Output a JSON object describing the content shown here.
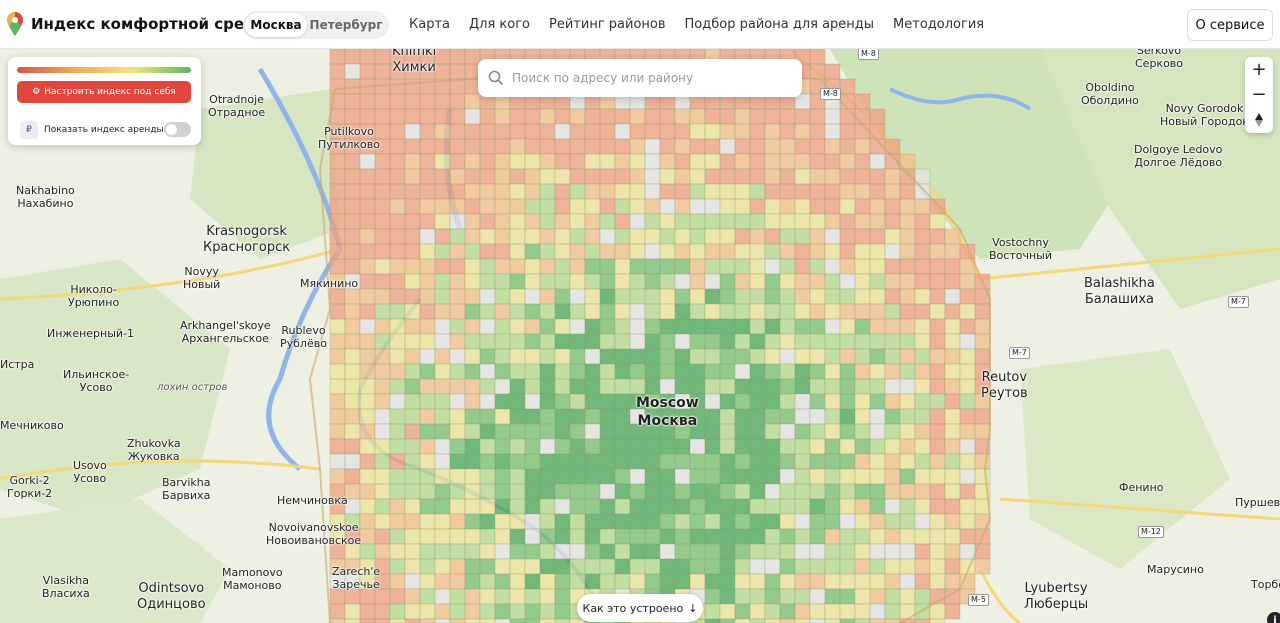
{
  "header": {
    "title": "Индекс комфортной среды",
    "cities": [
      "Москва",
      "Петербург"
    ],
    "nav": [
      "Карта",
      "Для кого",
      "Рейтинг районов",
      "Подбор района для аренды",
      "Методология"
    ],
    "about": "О сервисе"
  },
  "panel": {
    "customize": "Настроить индекс под себя",
    "ruble": "₽",
    "rent_toggle": "Показать индекс аренды",
    "rent_toggle_on": false
  },
  "search": {
    "placeholder": "Поиск по адресу или району"
  },
  "zoom": {
    "plus": "+",
    "minus": "−"
  },
  "bottom": {
    "how": "Как это устроено",
    "arrow": "↓",
    "info": "i"
  },
  "colors": {
    "accent": "#e0463c",
    "good": "#5cb85c",
    "bad": "#e9967a"
  },
  "map_labels": {
    "khimki": [
      "Khimki",
      "Химки"
    ],
    "otradnoe": [
      "Otradnoje",
      "Отрадное"
    ],
    "putilkovo": [
      "Putilkovo",
      "Путилково"
    ],
    "nakhabino": [
      "Nakhabino",
      "Нахабино"
    ],
    "krasnogorsk": [
      "Krasnogorsk",
      "Красногорск"
    ],
    "novyy": [
      "Novyy",
      "Новый"
    ],
    "myakinino": "Мякинино",
    "nikolo": [
      "Николо-",
      "Урюпино"
    ],
    "inzhenerny": "Инженерный-1",
    "arkhangelskoye": [
      "Arkhangel'skoye",
      "Архангельское"
    ],
    "rublevo": [
      "Rublevo",
      "Рублёво"
    ],
    "istra": "Истра",
    "ilinskoe": [
      "Ильинское-",
      "Усово"
    ],
    "lokhin": "лохин остров",
    "mechnikovo": "Мечниково",
    "zhukovka": [
      "Zhukovka",
      "Жуковка"
    ],
    "usovo": [
      "Usovo",
      "Усово"
    ],
    "gorki": [
      "Gorki-2",
      "Горки-2"
    ],
    "barvikha": [
      "Barvikha",
      "Барвиха"
    ],
    "nemchinovka": "Немчиновка",
    "novoivanovskoe": [
      "Novoivanovskoe",
      "Новоивановское"
    ],
    "zarechye": [
      "Zarech'e",
      "Заречье"
    ],
    "mamonovo": [
      "Mamonovo",
      "Мамоново"
    ],
    "vlasikha": [
      "Vlasikha",
      "Власиха"
    ],
    "odintsovo": [
      "Odintsovo",
      "Одинцово"
    ],
    "moscow": [
      "Moscow",
      "Москва"
    ],
    "serkovo": [
      "Serkovo",
      "Серково"
    ],
    "oboldino": [
      "Oboldino",
      "Оболдино"
    ],
    "novy_gorodok": [
      "Novy Gorodok",
      "Новый Городок"
    ],
    "dolgoye": [
      "Dolgoye Ledovo",
      "Долгое Лёдово"
    ],
    "vostochny": [
      "Vostochny",
      "Восточный"
    ],
    "balashikha": [
      "Balashikha",
      "Балашиха"
    ],
    "reutov": [
      "Reutov",
      "Реутов"
    ],
    "fenino": "Фенино",
    "purshevo": "Пуршево",
    "marusino": "Марусино",
    "lyubertsy": [
      "Lyubertsy",
      "Люберцы"
    ],
    "torbe": "Торбе"
  },
  "roads": {
    "m8a": "M-8",
    "m8b": "M-8",
    "m7a": "M-7",
    "m7b": "M-7",
    "m12": "M-12",
    "m5": "M-5"
  }
}
